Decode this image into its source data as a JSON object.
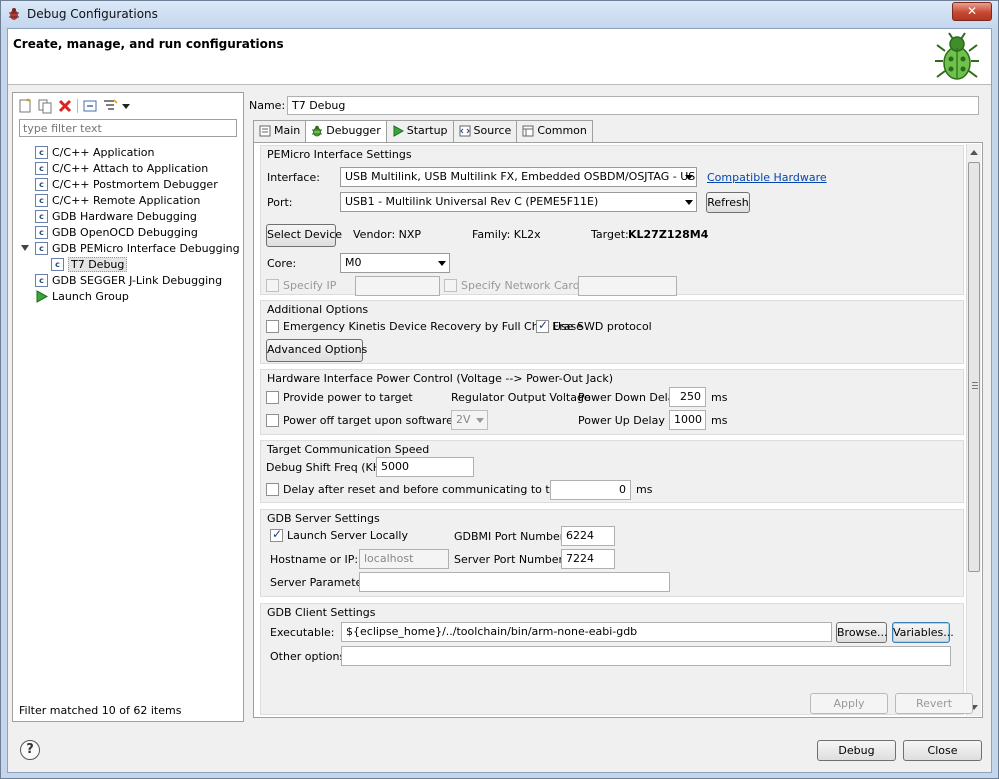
{
  "window": {
    "title": "Debug Configurations"
  },
  "banner": {
    "title": "Create, manage, and run configurations"
  },
  "left": {
    "filter_placeholder": "type filter text",
    "tree": [
      {
        "label": "C/C++ Application"
      },
      {
        "label": "C/C++ Attach to Application"
      },
      {
        "label": "C/C++ Postmortem Debugger"
      },
      {
        "label": "C/C++ Remote Application"
      },
      {
        "label": "GDB Hardware Debugging"
      },
      {
        "label": "GDB OpenOCD Debugging"
      },
      {
        "label": "GDB PEMicro Interface Debugging"
      },
      {
        "label": "T7 Debug"
      },
      {
        "label": "GDB SEGGER J-Link Debugging"
      },
      {
        "label": "Launch Group"
      }
    ],
    "status": "Filter matched 10 of 62 items"
  },
  "config": {
    "name_label": "Name:",
    "name_value": "T7 Debug",
    "tabs": [
      "Main",
      "Debugger",
      "Startup",
      "Source",
      "Common"
    ]
  },
  "pemicro": {
    "title": "PEMicro Interface Settings",
    "interface_label": "Interface:",
    "interface_value": "USB Multilink, USB Multilink FX, Embedded OSBDM/OSJTAG - USB Port",
    "compatible_link": "Compatible Hardware",
    "port_label": "Port:",
    "port_value": "USB1 - Multilink Universal Rev C (PEME5F11E)",
    "refresh_button": "Refresh",
    "select_device_button": "Select Device",
    "vendor": "Vendor:  NXP",
    "family": "Family:  KL2x",
    "target_label": "Target:",
    "target_value": "KL27Z128M4",
    "core_label": "Core:",
    "core_value": "M0",
    "specify_ip": "Specify IP",
    "specify_nic": "Specify Network Card IP"
  },
  "additional": {
    "title": "Additional Options",
    "emergency": "Emergency Kinetis Device Recovery by Full Chip Erase",
    "swd": "Use SWD protocol",
    "advanced_button": "Advanced Options"
  },
  "power": {
    "title": "Hardware Interface Power Control (Voltage --> Power-Out Jack)",
    "provide_power": "Provide power to target",
    "power_off": "Power off target upon software exit",
    "regulator_label": "Regulator Output Voltage",
    "regulator_value": "2V",
    "down_label": "Power Down Delay",
    "down_value": "250",
    "up_label": "Power Up Delay",
    "up_value": "1000",
    "ms": "ms"
  },
  "speed": {
    "title": "Target Communication Speed",
    "shift_label": "Debug Shift Freq (KHz)",
    "shift_value": "5000",
    "delay_label": "Delay after reset and before communicating to target for",
    "delay_value": "0",
    "ms": "ms"
  },
  "server": {
    "title": "GDB Server Settings",
    "launch_locally": "Launch Server Locally",
    "gdbmi_label": "GDBMI Port Number:",
    "gdbmi_value": "6224",
    "host_label": "Hostname or IP:",
    "host_value": "localhost",
    "port_label": "Server Port Number:",
    "port_value": "7224",
    "params_label": "Server Parameters:"
  },
  "client": {
    "title": "GDB Client Settings",
    "exec_label": "Executable:",
    "exec_value": "${eclipse_home}/../toolchain/bin/arm-none-eabi-gdb",
    "browse_button": "Browse...",
    "variables_button": "Variables...",
    "other_label": "Other options:"
  },
  "footer": {
    "apply": "Apply",
    "revert": "Revert",
    "debug": "Debug",
    "close": "Close"
  }
}
